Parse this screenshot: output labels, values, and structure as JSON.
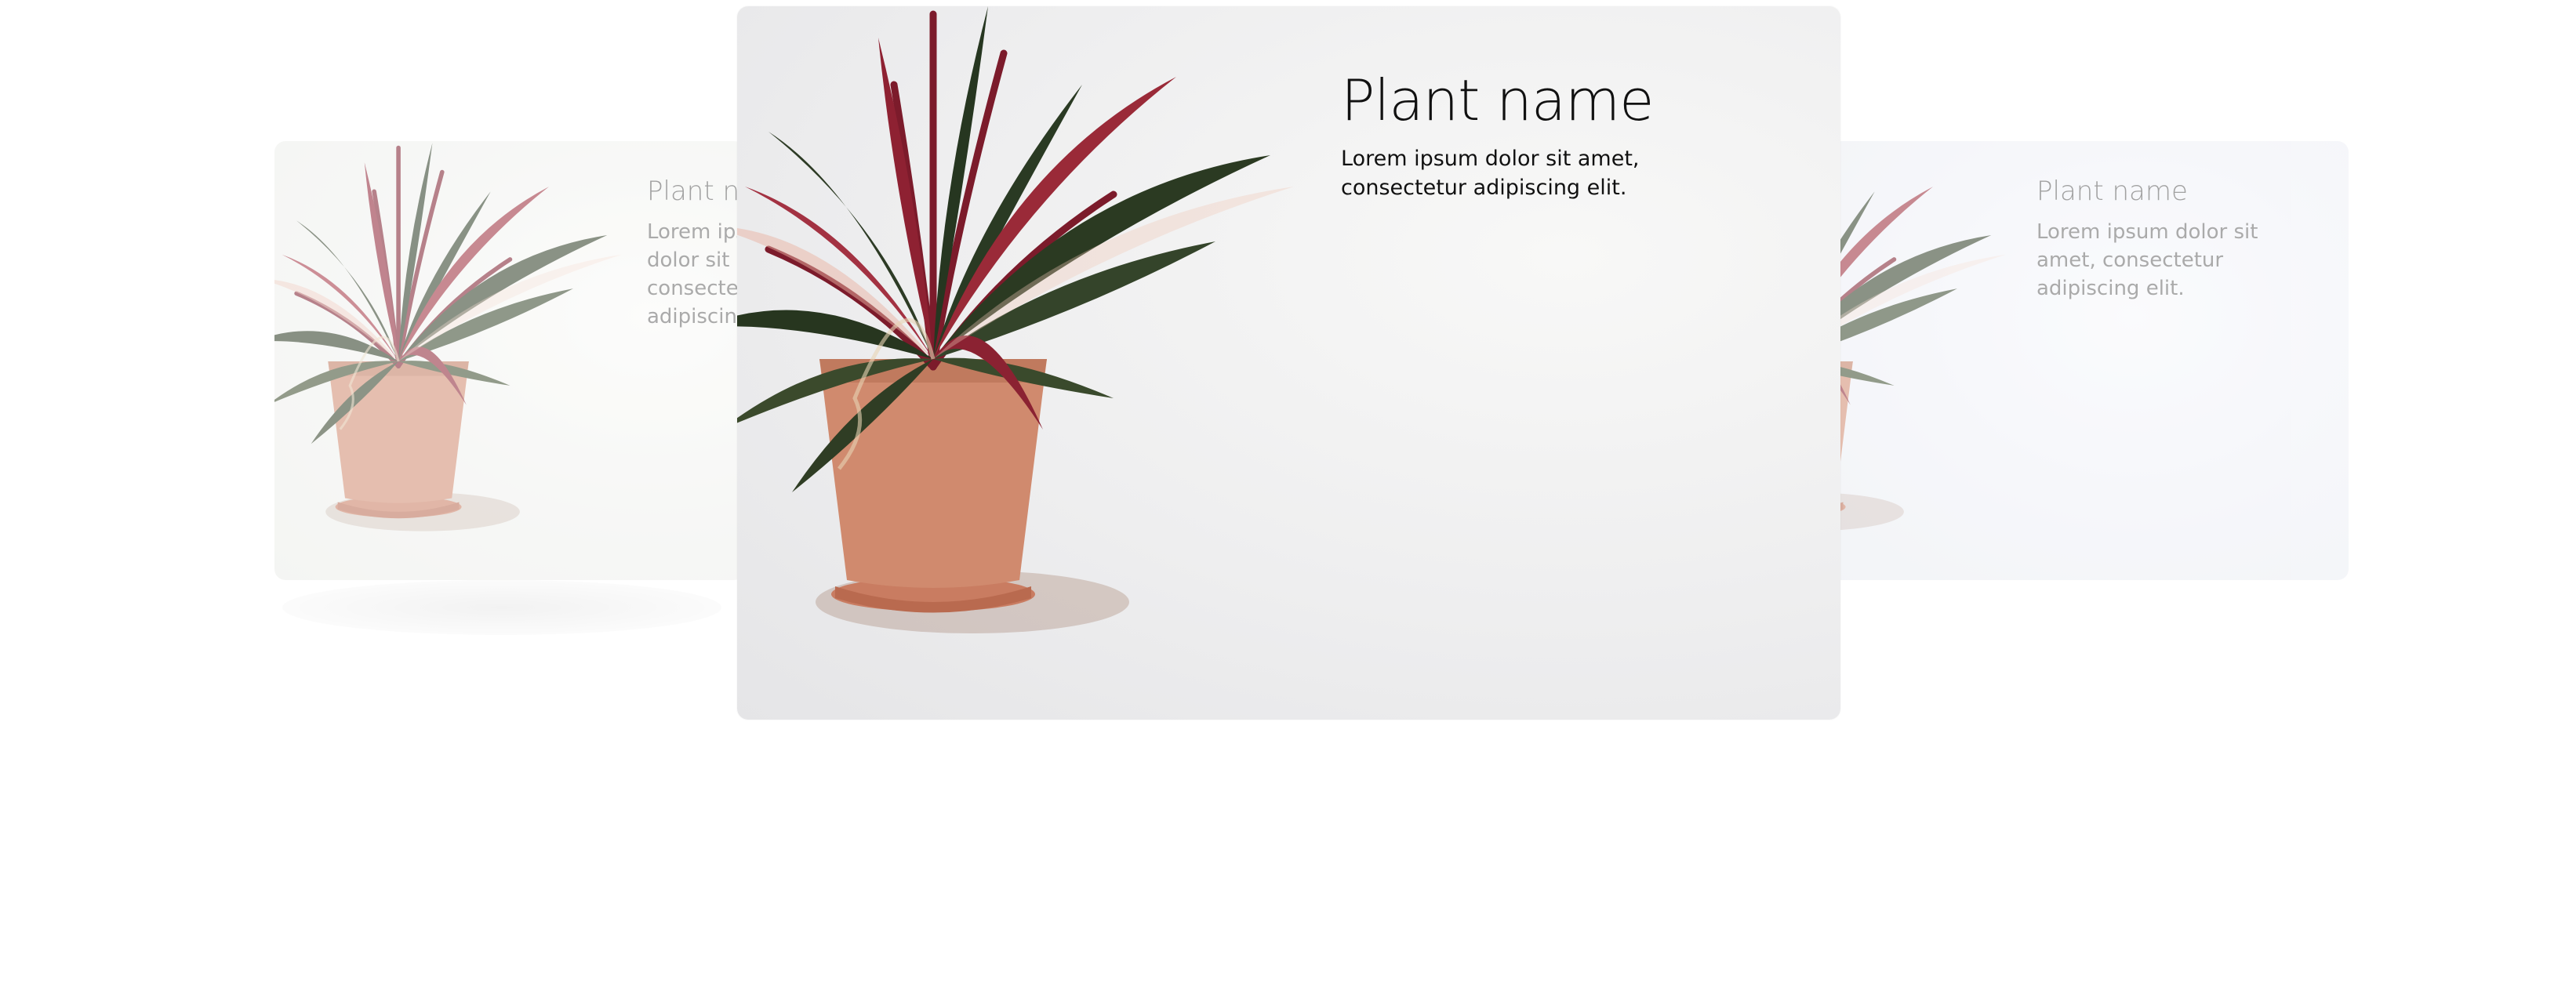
{
  "carousel": {
    "cards": [
      {
        "position": "previous",
        "title": "Plant name",
        "description": "Lorem ipsum dolor sit amet, consectetur adipiscing elit.",
        "image_icon": "potted-plant-image"
      },
      {
        "position": "active",
        "title": "Plant name",
        "description": "Lorem ipsum dolor sit amet, consectetur adipiscing elit.",
        "image_icon": "potted-plant-image"
      },
      {
        "position": "next",
        "title": "Plant name",
        "description": "Lorem ipsum dolor sit amet, consectetur adipiscing elit.",
        "image_icon": "potted-plant-image"
      }
    ]
  },
  "colors": {
    "pot": "#d08a6e",
    "leaf_dark": "#2a3a23",
    "leaf_red": "#8e2132",
    "leaf_pink": "#e9b3a4",
    "card_bg": "#eeeeef"
  }
}
